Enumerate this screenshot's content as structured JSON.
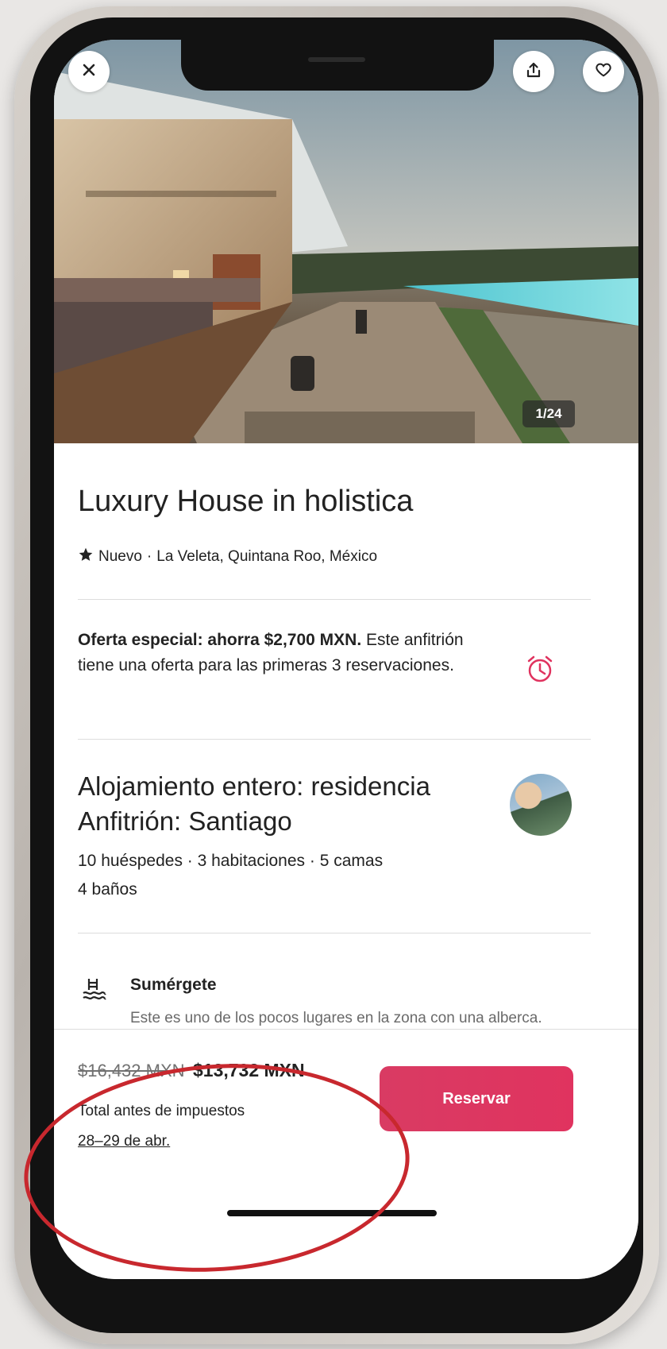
{
  "photo": {
    "counter": "1/24",
    "close_icon": "close-icon",
    "share_icon": "share-icon",
    "favorite_icon": "heart-icon"
  },
  "listing": {
    "title": "Luxury House in holistica",
    "status": "Nuevo",
    "separator": "·",
    "location": "La Veleta, Quintana Roo, México"
  },
  "offer": {
    "highlight": "Oferta especial: ahorra $2,700 MXN.",
    "text": "Este anfitrión tiene una oferta para las primeras 3 reservaciones.",
    "icon": "alarm-clock-icon",
    "icon_color": "#e0335f"
  },
  "host": {
    "title": "Alojamiento entero: residencia Anfitrión: Santiago",
    "details_line1": "10 huéspedes · 3 habitaciones · 5 camas",
    "details_line2": "4 baños"
  },
  "feature": {
    "icon": "pool-icon",
    "title": "Sumérgete",
    "description": "Este es uno de los pocos lugares en la zona con una alberca."
  },
  "booking": {
    "original_price": "$16,432 MXN",
    "price": "$13,732 MXN",
    "total_label": "Total antes de impuestos",
    "dates": "28–29 de abr.",
    "reserve_label": "Reservar",
    "accent_color": "#e0335f"
  },
  "annotation_color": "#c8282e"
}
